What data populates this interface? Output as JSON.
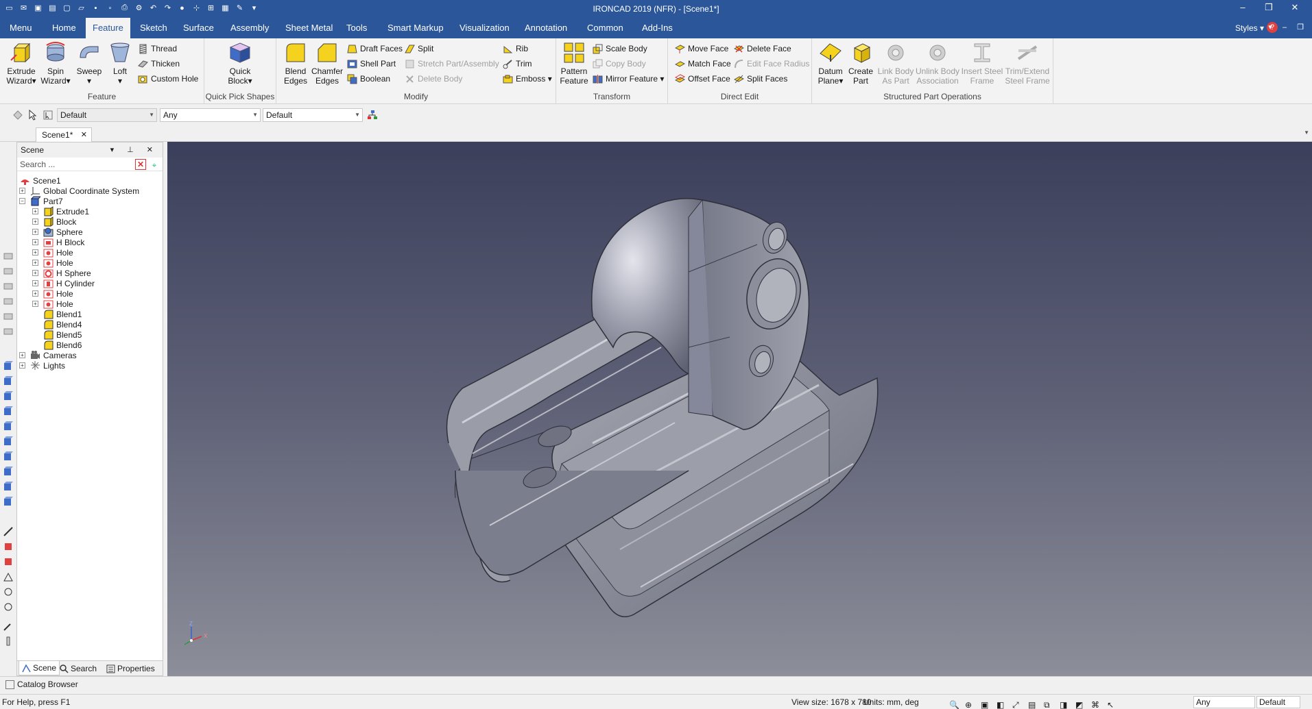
{
  "window": {
    "title": "IRONCAD 2019 (NFR) - [Scene1*]",
    "controls": [
      "–",
      "❐",
      "✕"
    ]
  },
  "ribbon_tabs": [
    "Menu",
    "Home",
    "Feature",
    "Sketch",
    "Surface",
    "Assembly",
    "Sheet Metal",
    "Tools",
    "Smart Markup",
    "Visualization",
    "Annotation",
    "Common",
    "Add-Ins"
  ],
  "active_tab": "Feature",
  "styles_label": "Styles",
  "groups": {
    "feature": {
      "label": "Feature",
      "extrude": [
        "Extrude",
        "Wizard"
      ],
      "spin": [
        "Spin",
        "Wizard"
      ],
      "sweep": "Sweep",
      "loft": "Loft",
      "thread": "Thread",
      "thicken": "Thicken",
      "custom_hole": "Custom Hole"
    },
    "quick_pick": {
      "label": "Quick Pick Shapes",
      "quick_block": [
        "Quick",
        "Block"
      ]
    },
    "modify": {
      "label": "Modify",
      "blend": [
        "Blend",
        "Edges"
      ],
      "chamfer": [
        "Chamfer",
        "Edges"
      ],
      "draft_faces": "Draft Faces",
      "shell_part": "Shell Part",
      "boolean": "Boolean",
      "split": "Split",
      "stretch": "Stretch Part/Assembly",
      "delete_body": "Delete Body",
      "rib": "Rib",
      "trim": "Trim",
      "emboss": "Emboss"
    },
    "transform": {
      "label": "Transform",
      "pattern": [
        "Pattern",
        "Feature"
      ],
      "scale_body": "Scale Body",
      "copy_body": "Copy Body",
      "mirror_feature": "Mirror Feature"
    },
    "direct_edit": {
      "label": "Direct Edit",
      "move_face": "Move Face",
      "match_face": "Match Face",
      "offset_face": "Offset Face",
      "delete_face": "Delete Face",
      "edit_face_radius": "Edit Face Radius",
      "split_faces": "Split Faces"
    },
    "structured": {
      "label": "Structured Part Operations",
      "datum_plane": [
        "Datum",
        "Plane"
      ],
      "create_part": [
        "Create",
        "Part"
      ],
      "link_body": [
        "Link Body",
        "As Part"
      ],
      "unlink_body": [
        "Unlink Body",
        "Association"
      ],
      "insert_steel": [
        "Insert Steel",
        "Frame"
      ],
      "trim_extend": [
        "Trim/Extend",
        "Steel Frame"
      ]
    }
  },
  "toolbar": {
    "combo1": "Default",
    "combo2": "Any",
    "combo3": "Default"
  },
  "doc_tab": "Scene1*",
  "scene_panel": {
    "title": "Scene",
    "search_placeholder": "Search ...",
    "tree": [
      {
        "label": "Scene1",
        "level": 0,
        "icon": "scene-icon"
      },
      {
        "label": "Global Coordinate System",
        "level": 1,
        "icon": "coordinate-system-icon",
        "exp": "+"
      },
      {
        "label": "Part7",
        "level": 1,
        "icon": "part-icon",
        "exp": "−"
      },
      {
        "label": "Extrude1",
        "level": 2,
        "icon": "extrude-icon",
        "exp": "+"
      },
      {
        "label": "Block",
        "level": 2,
        "icon": "block-icon",
        "exp": "+"
      },
      {
        "label": "Sphere",
        "level": 2,
        "icon": "sphere-icon",
        "exp": "+"
      },
      {
        "label": "H Block",
        "level": 2,
        "icon": "hole-block-icon",
        "exp": "+"
      },
      {
        "label": "Hole",
        "level": 2,
        "icon": "hole-icon",
        "exp": "+"
      },
      {
        "label": "Hole",
        "level": 2,
        "icon": "hole-icon",
        "exp": "+"
      },
      {
        "label": "H Sphere",
        "level": 2,
        "icon": "hole-sphere-icon",
        "exp": "+"
      },
      {
        "label": "H Cylinder",
        "level": 2,
        "icon": "hole-cylinder-icon",
        "exp": "+"
      },
      {
        "label": "Hole",
        "level": 2,
        "icon": "hole-icon",
        "exp": "+"
      },
      {
        "label": "Hole",
        "level": 2,
        "icon": "hole-icon",
        "exp": "+"
      },
      {
        "label": "Blend1",
        "level": 2,
        "icon": "blend-icon"
      },
      {
        "label": "Blend4",
        "level": 2,
        "icon": "blend-icon"
      },
      {
        "label": "Blend5",
        "level": 2,
        "icon": "blend-icon"
      },
      {
        "label": "Blend6",
        "level": 2,
        "icon": "blend-icon"
      },
      {
        "label": "Cameras",
        "level": 1,
        "icon": "camera-icon",
        "exp": "+"
      },
      {
        "label": "Lights",
        "level": 1,
        "icon": "light-icon",
        "exp": "+"
      }
    ],
    "bottom_tabs": [
      "Scene",
      "Search",
      "Properties"
    ]
  },
  "axis_labels": {
    "z": "Z",
    "x": "X"
  },
  "catalog_browser": "Catalog Browser",
  "status": {
    "help": "For Help, press F1",
    "view_size": "View size: 1678 x  780",
    "units": "Units: mm, deg",
    "combo_any": "Any",
    "combo_default": "Default"
  },
  "colors": {
    "accent": "#2b579a",
    "icon_yellow": "#f5d21d",
    "viewport_top": "#3b3f5b",
    "viewport_bottom": "#8c8e99"
  }
}
